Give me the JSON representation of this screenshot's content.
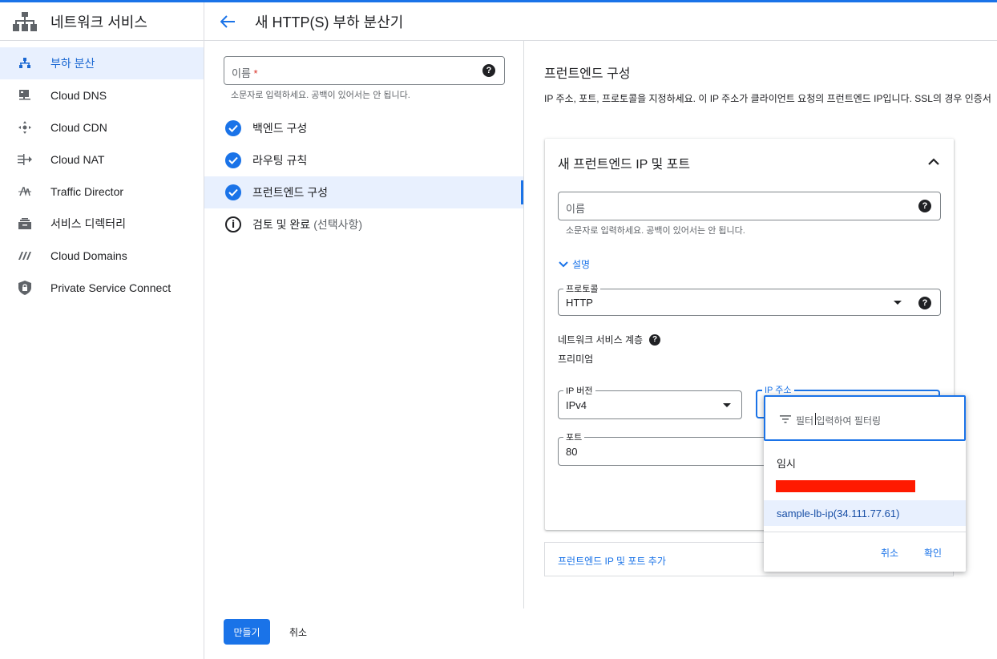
{
  "app": {
    "title": "네트워크 서비스",
    "accent_color": "#1a73e8",
    "header_icon": "network-topology-icon"
  },
  "sidebar": {
    "items": [
      {
        "label": "부하 분산",
        "icon": "load-balancer-icon",
        "active": true
      },
      {
        "label": "Cloud DNS",
        "icon": "dns-server-icon",
        "active": false
      },
      {
        "label": "Cloud CDN",
        "icon": "cdn-icon",
        "active": false
      },
      {
        "label": "Cloud NAT",
        "icon": "nat-icon",
        "active": false
      },
      {
        "label": "Traffic Director",
        "icon": "traffic-director-icon",
        "active": false
      },
      {
        "label": "서비스 디렉터리",
        "icon": "service-directory-icon",
        "active": false
      },
      {
        "label": "Cloud Domains",
        "icon": "domains-icon",
        "active": false
      },
      {
        "label": "Private Service Connect",
        "icon": "lock-shield-icon",
        "active": false
      }
    ]
  },
  "page": {
    "title": "새 HTTP(S) 부하 분산기",
    "back_icon": "arrow-back-icon"
  },
  "steps_panel": {
    "name_placeholder": "이름",
    "required_mark": "*",
    "name_hint": "소문자로 입력하세요. 공백이 있어서는 안 됩니다.",
    "steps": [
      {
        "label": "백엔드 구성",
        "status": "complete",
        "optional_text": ""
      },
      {
        "label": "라우팅 규칙",
        "status": "complete",
        "optional_text": ""
      },
      {
        "label": "프런트엔드 구성",
        "status": "complete",
        "optional_text": ""
      },
      {
        "label": "검토 및 완료",
        "status": "info",
        "optional_text": "(선택사항)"
      }
    ]
  },
  "frontend": {
    "section_title": "프런트엔드 구성",
    "section_description": "IP 주소, 포트, 프로토콜을 지정하세요. 이 IP 주소가 클라이언트 요청의 프런트엔드 IP입니다. SSL의 경우 인증서",
    "card_title": "새 프런트엔드 IP 및 포트",
    "name_placeholder": "이름",
    "name_hint": "소문자로 입력하세요. 공백이 있어서는 안 됩니다.",
    "description_toggle": "설명",
    "protocol": {
      "label": "프로토콜",
      "value": "HTTP"
    },
    "network_tier": {
      "label": "네트워크 서비스 계층",
      "value": "프리미엄"
    },
    "ip_version": {
      "label": "IP 버전",
      "value": "IPv4"
    },
    "ip_address": {
      "label": "IP 주소",
      "value": ""
    },
    "port": {
      "label": "포트",
      "value": "80"
    },
    "add_link": "프런트엔드 IP 및 포트 추가"
  },
  "ip_dropdown": {
    "filter_placeholder": "필터 입력하여 필터링",
    "options": [
      {
        "label": "임시",
        "selected": false
      },
      {
        "label": "",
        "redacted": true,
        "selected": false
      },
      {
        "label": "sample-lb-ip(34.111.77.61)",
        "selected": true
      }
    ],
    "cancel_label": "취소",
    "ok_label": "확인"
  },
  "footer": {
    "create_label": "만들기",
    "cancel_label": "취소"
  }
}
